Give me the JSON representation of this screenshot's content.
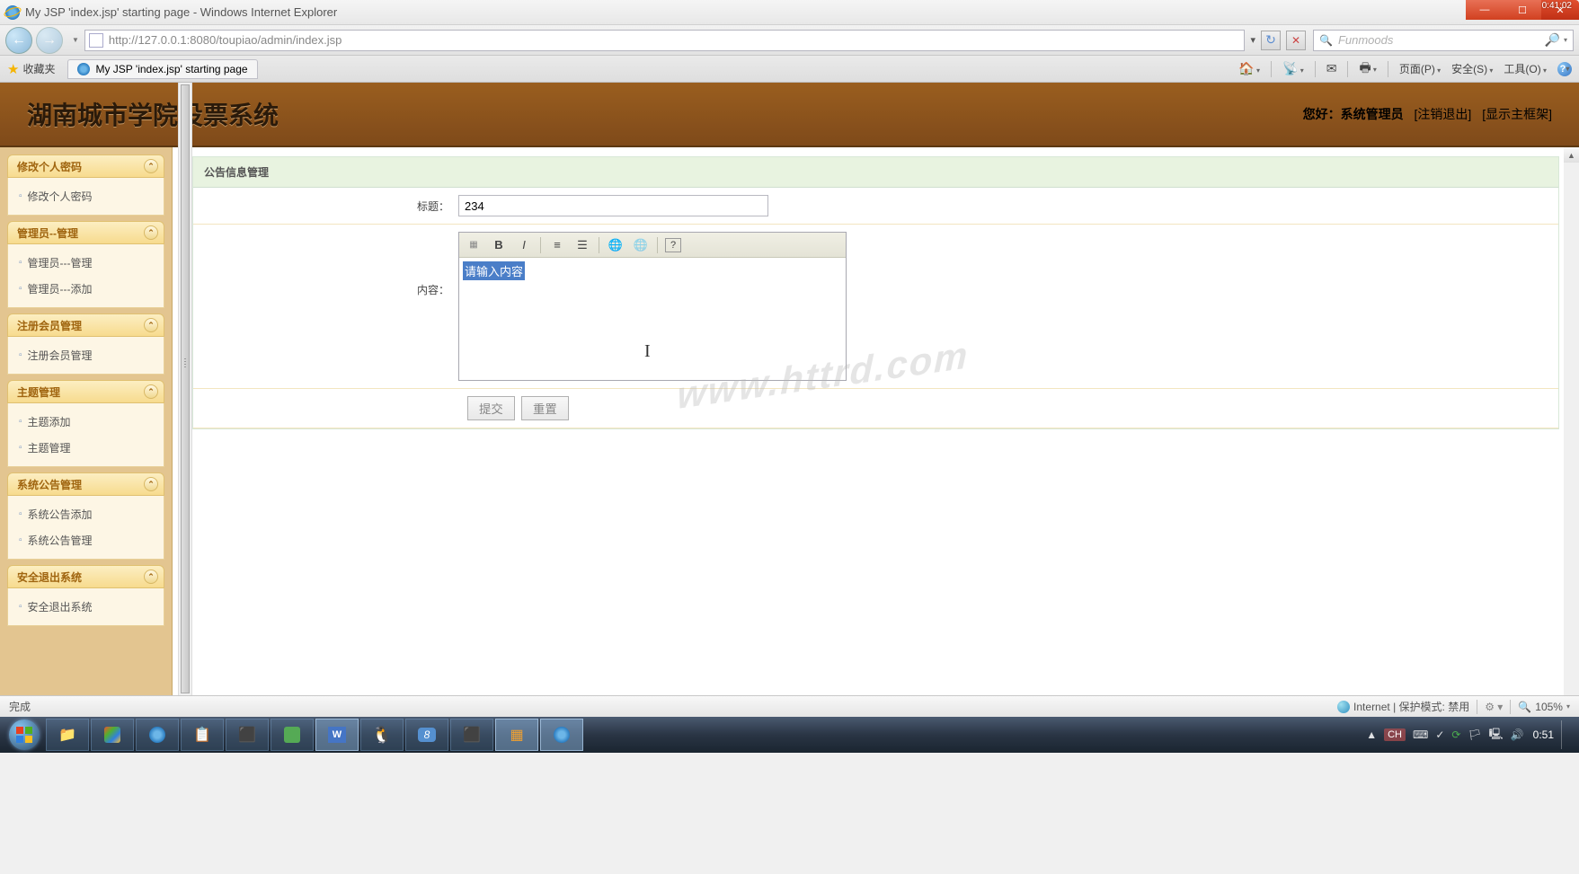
{
  "window": {
    "title": "My JSP 'index.jsp' starting page - Windows Internet Explorer",
    "time_overlay": "0:41:02"
  },
  "nav": {
    "url": "http://127.0.0.1:8080/toupiao/admin/index.jsp",
    "search_placeholder": "Funmoods"
  },
  "favorites": {
    "label": "收藏夹",
    "tab_title": "My JSP 'index.jsp' starting page"
  },
  "commands": {
    "page": "页面(P)",
    "safety": "安全(S)",
    "tools": "工具(O)"
  },
  "banner": {
    "title": "湖南城市学院投票系统",
    "greeting": "您好：系统管理员",
    "logout": "[注销退出]",
    "showframe": "[显示主框架]"
  },
  "sidebar": [
    {
      "title": "修改个人密码",
      "items": [
        "修改个人密码"
      ]
    },
    {
      "title": "管理员--管理",
      "items": [
        "管理员---管理",
        "管理员---添加"
      ]
    },
    {
      "title": "注册会员管理",
      "items": [
        "注册会员管理"
      ]
    },
    {
      "title": "主题管理",
      "items": [
        "主题添加",
        "主题管理"
      ]
    },
    {
      "title": "系统公告管理",
      "items": [
        "系统公告添加",
        "系统公告管理"
      ]
    },
    {
      "title": "安全退出系统",
      "items": [
        "安全退出系统"
      ]
    }
  ],
  "main": {
    "panel_title": "公告信息管理",
    "title_label": "标题：",
    "title_value": "234",
    "content_label": "内容：",
    "editor_placeholder": "请输入内容",
    "submit": "提交",
    "reset": "重置"
  },
  "watermark": "www.httrd.com",
  "status": {
    "done": "完成",
    "zone": "Internet | 保护模式: 禁用",
    "zoom": "105%"
  },
  "tray": {
    "ime": "CH",
    "time": "0:51"
  }
}
